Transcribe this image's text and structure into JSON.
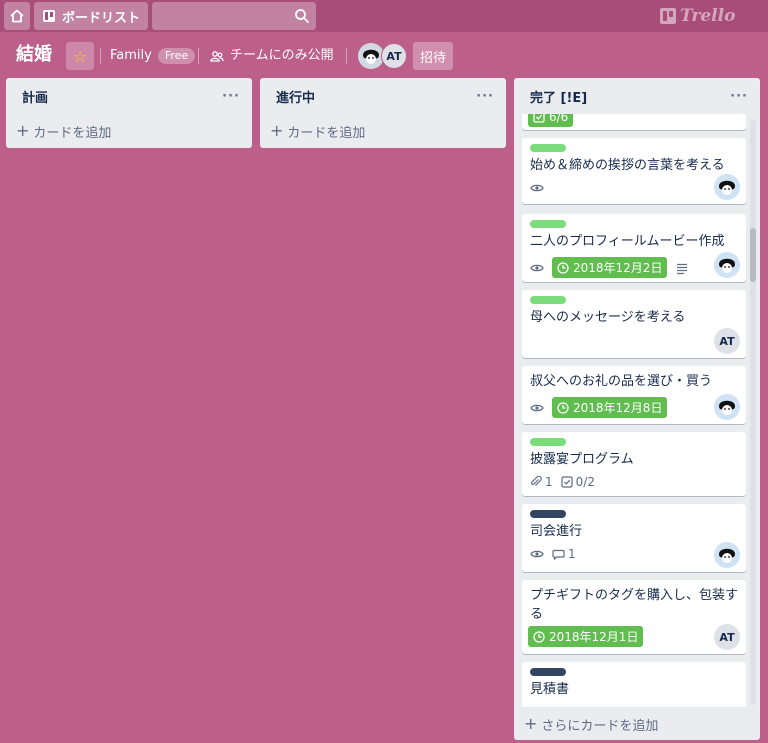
{
  "topbar": {
    "home_icon": "home-icon",
    "boards_label": "ボードリスト",
    "search_placeholder": "",
    "logo_text": "Trello"
  },
  "board": {
    "title": "結婚",
    "team": "Family",
    "team_badge": "Free",
    "visibility": "チームにのみ公開",
    "invite_label": "招待",
    "members": [
      {
        "initials": "",
        "avatar": "character-avatar"
      },
      {
        "initials": "AT"
      }
    ]
  },
  "lists": [
    {
      "name": "計画",
      "menu": "···",
      "add_card": "カードを追加"
    },
    {
      "name": "進行中",
      "menu": "···",
      "add_card": "カードを追加"
    },
    {
      "name": "完了 [!E]",
      "menu": "···",
      "add_card": "さらにカードを追加",
      "partial_card_badge": "6/6",
      "cards": [
        {
          "label_color": "#7bdc7b",
          "title": "始め＆締めの挨拶の言葉を考える",
          "badges": [
            "watch"
          ],
          "avatar": "character"
        },
        {
          "label_color": "#7bdc7b",
          "title": "二人のプロフィールムービー作成",
          "due": "2018年12月2日",
          "badges": [
            "watch",
            "description"
          ],
          "avatar": "character"
        },
        {
          "label_color": "#7bdc7b",
          "title": "母へのメッセージを考える",
          "avatar": "AT"
        },
        {
          "title": "叔父へのお礼の品を選び・買う",
          "due": "2018年12月8日",
          "badges": [
            "watch"
          ],
          "avatar": "character"
        },
        {
          "label_color": "#7bdc7b",
          "title": "披露宴プログラム",
          "attachments": "1",
          "checklist": "0/2"
        },
        {
          "label_color": "#344563",
          "title": "司会進行",
          "comments": "1",
          "badges": [
            "watch"
          ],
          "avatar": "character"
        },
        {
          "title": "プチギフトのタグを購入し、包装する",
          "due": "2018年12月1日",
          "avatar": "AT"
        },
        {
          "label_color": "#344563",
          "title": "見積書"
        }
      ]
    }
  ]
}
